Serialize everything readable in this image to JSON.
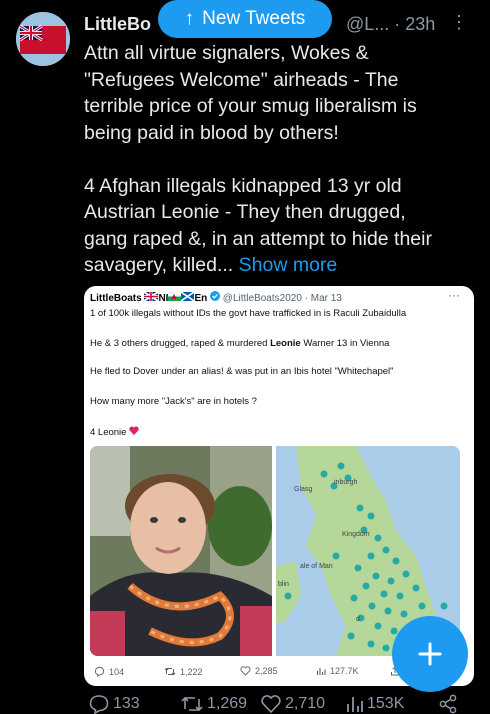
{
  "tweet": {
    "author_name": "LittleBo",
    "handle_time": "@L... · 23h",
    "more_label": "⋮",
    "text": "Attn all virtue signalers, Wokes &\n\"Refugees Welcome\" airheads - The\nterrible price of your smug liberalism is\nbeing paid in blood by others!\n\n4 Afghan illegals kidnapped 13 yr old\nAustrian Leonie - They then drugged,\ngang raped &, in an attempt to hide their\nsavagery, killed... ",
    "show_more": "Show more",
    "reply_count": "133",
    "retweet_count": "1,269",
    "like_count": "2,710",
    "view_count": "153K"
  },
  "new_tweets": {
    "arrow": "↑",
    "label": "New Tweets"
  },
  "quoted": {
    "author": "LittleBoats",
    "flags_text": "NI",
    "flags_text2": "En",
    "handle_date": "@LittleBoats2020 · Mar 13",
    "more": "···",
    "line1": "1 of 100k illegals without IDs the govt have trafficked in is Raculi Zubaidulla",
    "line2_a": "He & 3 others drugged, raped & murdered ",
    "line2_b": "Leonie",
    "line2_c": " Warner 13 in Vienna",
    "line3": "He fled to Dover under an alias! & was put in an Ibis hotel \"Whitechapel\"",
    "line4": "How many more \"Jack's\" are in hotels ?",
    "line5": "4 Leonie",
    "map_labels": [
      "Glasg",
      "inburgh",
      "Kingdom",
      "ale of Man",
      "blin",
      "d"
    ],
    "reply_count": "104",
    "retweet_count": "1,222",
    "like_count": "2,285",
    "view_count": "127.7K"
  },
  "fab": {
    "label": "+"
  },
  "colors": {
    "accent": "#1d9bf0",
    "background": "#000000",
    "muted": "#8b98a5"
  }
}
